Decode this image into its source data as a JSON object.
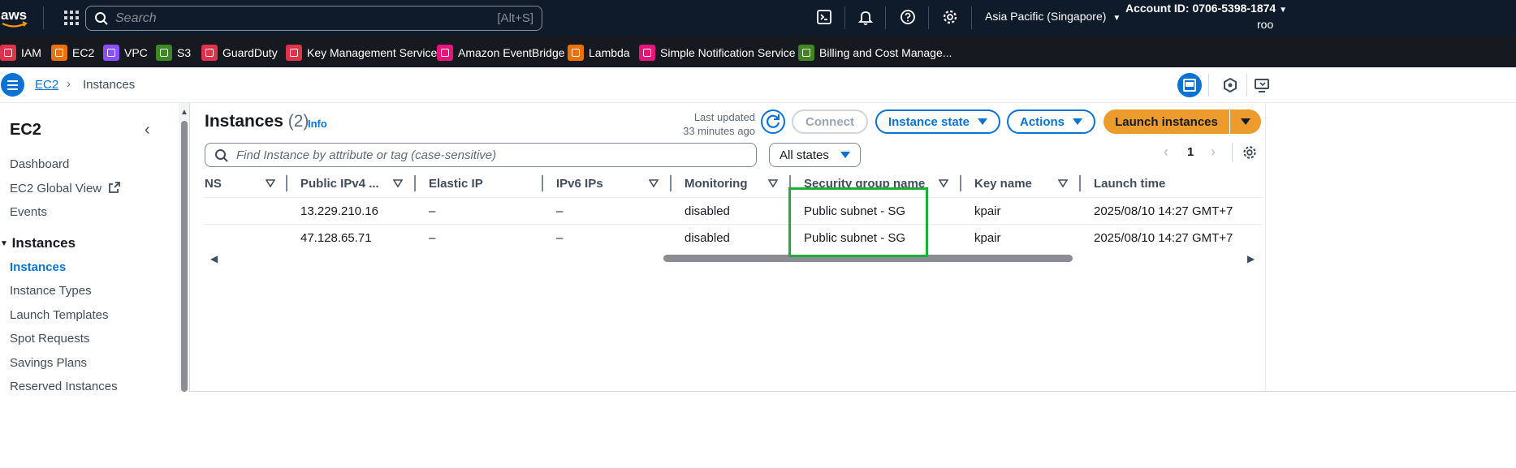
{
  "top_nav": {
    "logo": "aws",
    "search_placeholder": "Search",
    "search_shortcut": "[Alt+S]",
    "icons": [
      "cloudshell-icon",
      "bell-icon",
      "help-icon",
      "gear-icon"
    ],
    "region": "Asia Pacific (Singapore)",
    "account": "Account ID: 0706-5398-1874",
    "account_line2": "roo"
  },
  "favorites": [
    {
      "label": "IAM",
      "color": "#dd344c"
    },
    {
      "label": "EC2",
      "color": "#ed7100"
    },
    {
      "label": "VPC",
      "color": "#8c4fff"
    },
    {
      "label": "S3",
      "color": "#3f8624"
    },
    {
      "label": "GuardDuty",
      "color": "#dd344c"
    },
    {
      "label": "Key Management Service",
      "color": "#dd344c"
    },
    {
      "label": "Amazon EventBridge",
      "color": "#e7157b"
    },
    {
      "label": "Lambda",
      "color": "#ed7100"
    },
    {
      "label": "Simple Notification Service",
      "color": "#e7157b"
    },
    {
      "label": "Billing and Cost Manage...",
      "color": "#3f8624"
    }
  ],
  "breadcrumb": {
    "root": "EC2",
    "current": "Instances"
  },
  "sidebar": {
    "title": "EC2",
    "items": [
      {
        "label": "Dashboard"
      },
      {
        "label": "EC2 Global View"
      },
      {
        "label": "Events"
      }
    ],
    "section": "Instances",
    "section_items": [
      {
        "label": "Instances"
      },
      {
        "label": "Instance Types"
      },
      {
        "label": "Launch Templates"
      },
      {
        "label": "Spot Requests"
      },
      {
        "label": "Savings Plans"
      },
      {
        "label": "Reserved Instances"
      }
    ]
  },
  "main": {
    "title": "Instances",
    "count": "(2)",
    "info": "Info",
    "last_updated_label": "Last updated",
    "last_updated_value": "33 minutes ago",
    "connect": "Connect",
    "instance_state": "Instance state",
    "actions": "Actions",
    "launch": "Launch instances",
    "filter_placeholder": "Find Instance by attribute or tag (case-sensitive)",
    "states_filter": "All states",
    "page": "1"
  },
  "table": {
    "columns": [
      "NS",
      "Public IPv4 ...",
      "Elastic IP",
      "IPv6 IPs",
      "Monitoring",
      "Security group name",
      "Key name",
      "Launch time"
    ],
    "rows": [
      [
        "",
        "13.229.210.16",
        "–",
        "–",
        "disabled",
        "Public subnet - SG",
        "kpair",
        "2025/08/10 14:27 GMT+7"
      ],
      [
        "",
        "47.128.65.71",
        "–",
        "–",
        "disabled",
        "Public subnet - SG",
        "kpair",
        "2025/08/10 14:27 GMT+7"
      ]
    ]
  },
  "colors": {
    "nav_bg": "#0f1b2a",
    "fav_bg": "#16191f",
    "accent": "#0972d3",
    "primary": "#ec9b2c",
    "highlight": "#1fae3a"
  }
}
